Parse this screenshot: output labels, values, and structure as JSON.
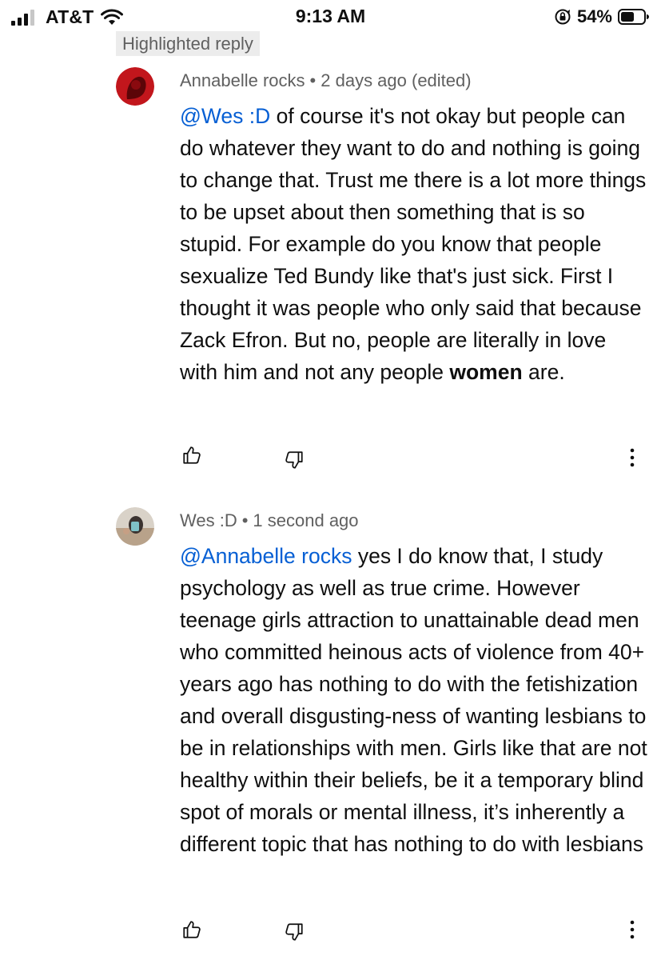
{
  "status_bar": {
    "carrier": "AT&T",
    "time": "9:13 AM",
    "battery": "54%"
  },
  "highlight_badge": "Highlighted reply",
  "comments": [
    {
      "author": "Annabelle rocks",
      "separator": "•",
      "timestamp": "2 days ago (edited)",
      "mention": "@Wes :D",
      "text_main": " of course it's not okay but people can do whatever they want to do and nothing is going to change that. Trust me there is a lot more things to be upset about then something that is so stupid. For example do you know that people sexualize Ted Bundy like that's just sick. First I thought it was people who only said that because Zack Efron. But no, people are literally in love with him and not any people ",
      "text_bold": "women",
      "text_end": " are."
    },
    {
      "author": "Wes :D",
      "separator": "•",
      "timestamp": "1 second ago",
      "mention": "@Annabelle rocks",
      "text_main": " yes I do know that, I study psychology as well as true crime. However teenage girls attraction to unattainable dead men who committed heinous acts of violence from 40+ years ago has nothing to do with the fetishization and overall disgusting-ness of wanting lesbians to be in relationships with men. Girls like that are not healthy within their beliefs, be it a temporary blind spot of morals or mental illness, it’s inherently a different topic that has nothing to do with lesbians"
    }
  ],
  "icons": {
    "signal": "signal-icon",
    "wifi": "wifi-icon",
    "rotation_lock": "rotation-lock-icon",
    "battery": "battery-icon",
    "like": "thumbs-up-icon",
    "dislike": "thumbs-down-icon",
    "more": "more-vert-icon"
  },
  "colors": {
    "mention": "#065fd4",
    "meta": "#606060",
    "text": "#0f0f0f",
    "badge_bg": "#ececec",
    "avatar_1": "#b0141a"
  }
}
